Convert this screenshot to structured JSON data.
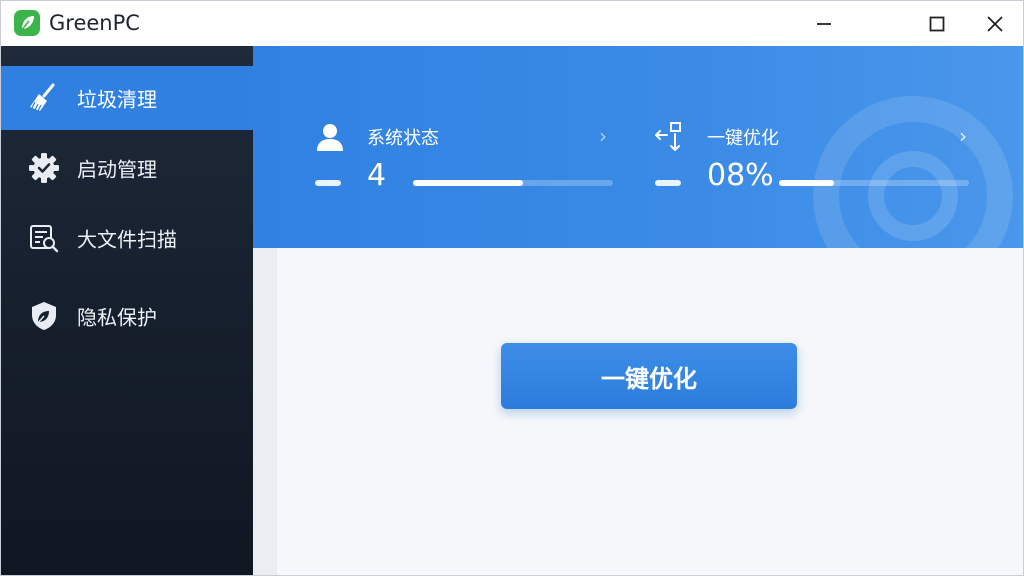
{
  "window": {
    "title": "GreenPC",
    "controls": [
      "minimize-icon",
      "maximize-icon",
      "close-icon"
    ]
  },
  "sidebar": {
    "items": [
      {
        "label": "垃圾清理",
        "icon": "broom-icon",
        "active": true
      },
      {
        "label": "启动管理",
        "icon": "gear-icon",
        "active": false
      },
      {
        "label": "大文件扫描",
        "icon": "file-search-icon",
        "active": false
      },
      {
        "label": "隐私保护",
        "icon": "shield-leaf-icon",
        "active": false
      }
    ]
  },
  "header": {
    "system_status": {
      "label": "系统状态",
      "value": "4",
      "icon": "user-icon",
      "progress": 0.55
    },
    "quick_optimize": {
      "label": "一键优化",
      "value": "08%",
      "icon": "transfer-icon",
      "progress": 0.29
    }
  },
  "main": {
    "optimize_button_label": "一键优化"
  },
  "colors": {
    "accent": "#2f80e0",
    "sidebar_bg": "#17202e",
    "logo_green": "#3bb44a",
    "content_bg": "#f5f7fa"
  }
}
